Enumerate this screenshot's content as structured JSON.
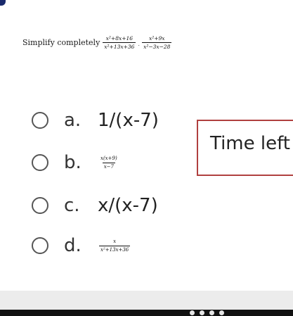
{
  "question": {
    "prompt": "Simplify completely",
    "fraction1": {
      "numerator": "x²+8x+16",
      "denominator": "x²+13x+36"
    },
    "operator": "·",
    "fraction2": {
      "numerator": "x²+9x",
      "denominator": "x²−3x−28"
    }
  },
  "options": [
    {
      "letter": "a.",
      "text": "1/(x-7)"
    },
    {
      "letter": "b.",
      "numerator": "x(x+9)",
      "denominator": "x−7"
    },
    {
      "letter": "c.",
      "text": "x/(x-7)"
    },
    {
      "letter": "d.",
      "numerator": "x",
      "denominator": "x²+13x+36"
    }
  ],
  "timer": {
    "label": "Time left"
  },
  "colors": {
    "timer_border": "#b0403f",
    "background": "#ececec",
    "card": "#ffffff"
  }
}
